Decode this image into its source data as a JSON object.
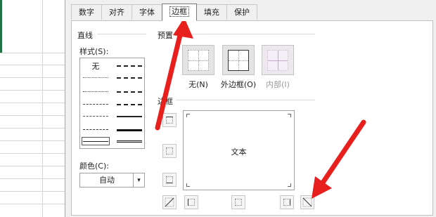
{
  "tabs": [
    "数字",
    "对齐",
    "字体",
    "边框",
    "填充",
    "保护"
  ],
  "active_tab": "边框",
  "line": {
    "group_title": "直线",
    "style_label": "样式(S):",
    "none_label": "无",
    "color_label": "颜色(C):",
    "color_value": "自动"
  },
  "presets": {
    "group_title": "预置",
    "items": [
      {
        "label": "无(N)",
        "enabled": true
      },
      {
        "label": "外边框(O)",
        "enabled": true
      },
      {
        "label": "内部(I)",
        "enabled": false
      }
    ]
  },
  "border": {
    "group_title": "边框",
    "preview_text": "文本"
  },
  "colors": {
    "arrow": "#e8201d",
    "selection": "#217346"
  }
}
